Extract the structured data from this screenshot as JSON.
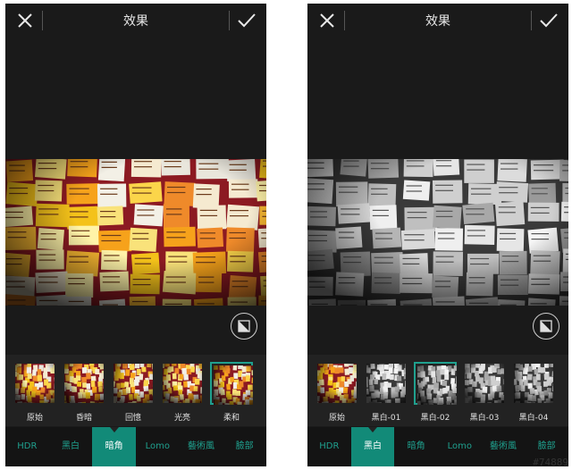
{
  "screens": [
    {
      "title": "效果",
      "mode": "color",
      "filters": [
        {
          "label": "原始",
          "selected": false
        },
        {
          "label": "昏暗",
          "selected": false
        },
        {
          "label": "回憶",
          "selected": false
        },
        {
          "label": "光亮",
          "selected": false
        },
        {
          "label": "柔和",
          "selected": true
        }
      ],
      "tabs": [
        {
          "label": "HDR",
          "active": false
        },
        {
          "label": "黑白",
          "active": false
        },
        {
          "label": "暗角",
          "active": true
        },
        {
          "label": "Lomo",
          "active": false
        },
        {
          "label": "藝術風",
          "active": false
        },
        {
          "label": "臉部",
          "active": false
        }
      ]
    },
    {
      "title": "效果",
      "mode": "bw",
      "filters": [
        {
          "label": "原始",
          "selected": false
        },
        {
          "label": "黑白-01",
          "selected": false
        },
        {
          "label": "黑白-02",
          "selected": true
        },
        {
          "label": "黑白-03",
          "selected": false
        },
        {
          "label": "黑白-04",
          "selected": false
        }
      ],
      "tabs": [
        {
          "label": "HDR",
          "active": false
        },
        {
          "label": "黑白",
          "active": true
        },
        {
          "label": "暗角",
          "active": false
        },
        {
          "label": "Lomo",
          "active": false
        },
        {
          "label": "藝術風",
          "active": false
        },
        {
          "label": "臉部",
          "active": false
        }
      ]
    }
  ],
  "colors": {
    "accent": "#1fa08e",
    "active_tab": "#128a78"
  },
  "watermark": "#74889"
}
